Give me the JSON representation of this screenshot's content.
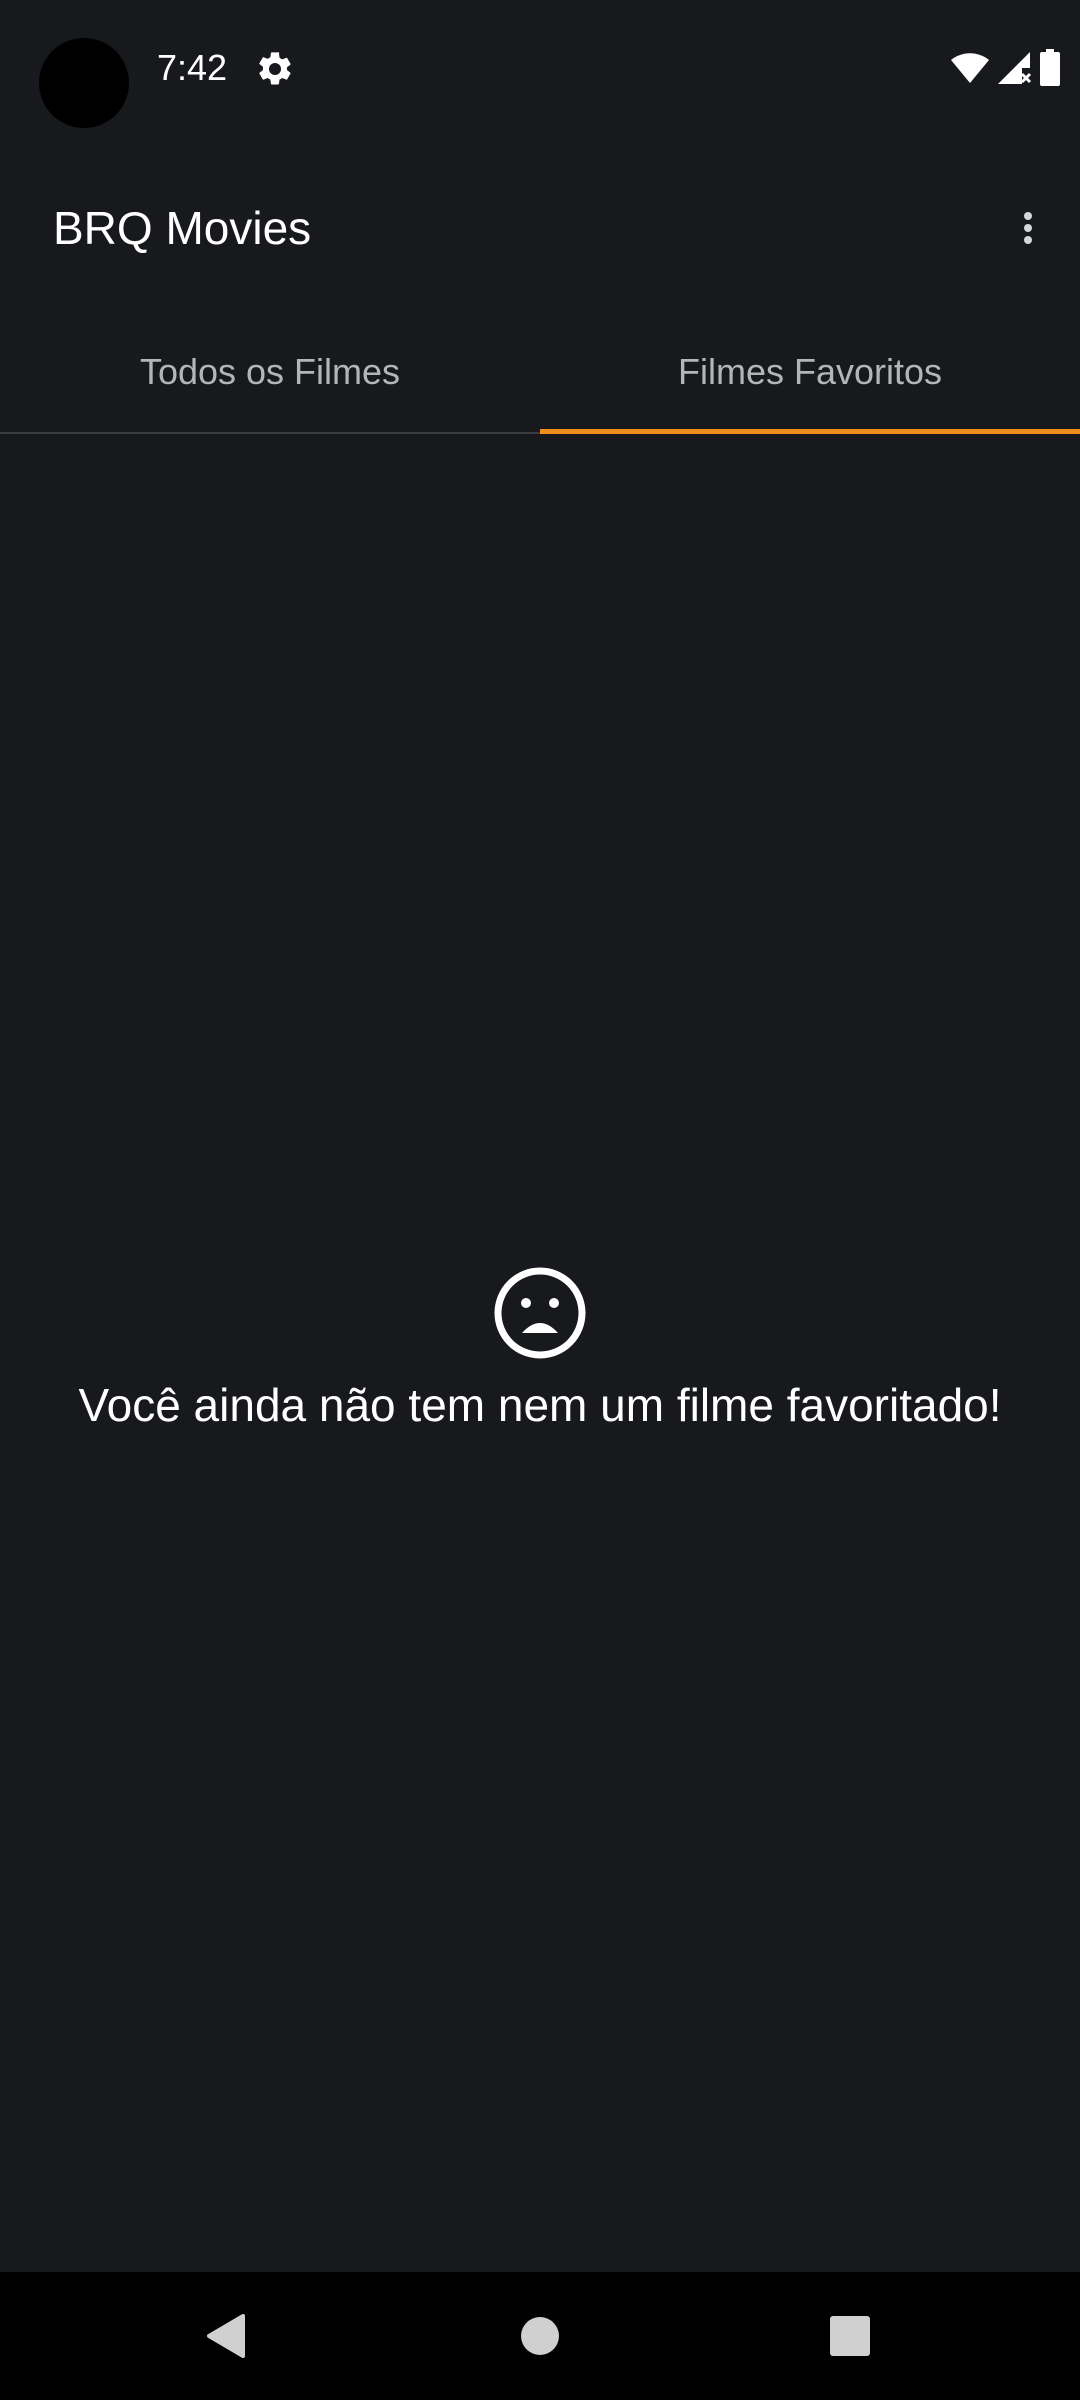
{
  "status_bar": {
    "time": "7:42",
    "icons": [
      "settings-icon",
      "wifi-icon",
      "signal-icon",
      "battery-icon"
    ]
  },
  "app_bar": {
    "title": "BRQ Movies",
    "menu_icon": "more-vert-icon"
  },
  "tabs": [
    {
      "label": "Todos os Filmes",
      "selected": false
    },
    {
      "label": "Filmes Favoritos",
      "selected": true
    }
  ],
  "empty_state": {
    "icon": "sad-face-icon",
    "message": "Você ainda não tem nem um filme favoritado!"
  },
  "nav_bar": {
    "icons": [
      "back-icon",
      "home-icon",
      "recents-icon"
    ]
  },
  "colors": {
    "background": "#18191c",
    "accent": "#f08c1a",
    "text_primary": "#ffffff",
    "text_secondary": "#b3b5ba"
  }
}
